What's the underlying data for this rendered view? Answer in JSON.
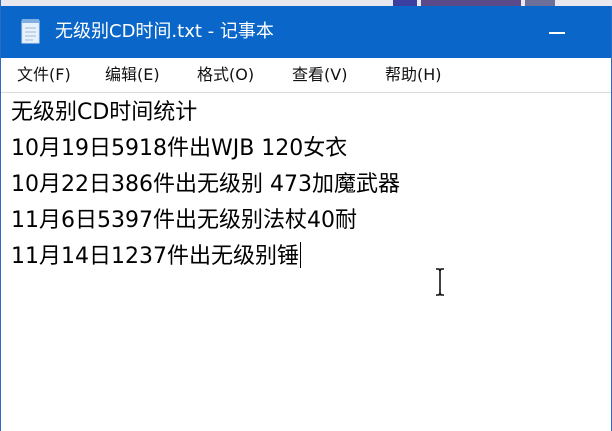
{
  "window": {
    "title": "无级别CD时间.txt - 记事本"
  },
  "menu": {
    "items": [
      {
        "label": "文件(F)"
      },
      {
        "label": "编辑(E)"
      },
      {
        "label": "格式(O)"
      },
      {
        "label": "查看(V)"
      },
      {
        "label": "帮助(H)"
      }
    ]
  },
  "editor": {
    "lines": [
      "无级别CD时间统计",
      "10月19日5918件出WJB  120女衣",
      "10月22日386件出无级别 473加魔武器",
      "11月6日5397件出无级别法杖40耐",
      "11月14日1237件出无级别锤"
    ]
  },
  "colors": {
    "titlebar": "#0a66c9",
    "title_text": "#ffffff",
    "text": "#000000"
  },
  "icons": {
    "app": "notepad-icon",
    "minimize": "minimize-icon",
    "cursor": "text-cursor-icon"
  }
}
